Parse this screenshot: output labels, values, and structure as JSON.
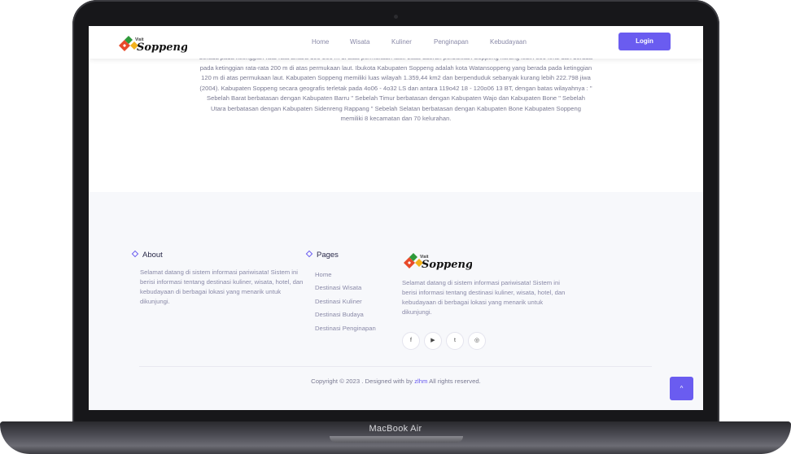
{
  "device": {
    "label": "MacBook Air"
  },
  "brand": {
    "small": "Visit",
    "name": "Soppeng",
    "accent": "#6a5cf0"
  },
  "navbar": {
    "items": [
      "Home",
      "Wisata",
      "Kuliner",
      "Penginapan",
      "Kebudayaan"
    ],
    "login_label": "Login"
  },
  "about_section": {
    "paragraph": "berada pada ketinggian rata-rata antara 100-200 m di atas permukaan laut. Luas daerah perbukitan Soppeng kurang lebih 800 km2 dan berada pada ketinggian rata-rata 200 m di atas permukaan laut. Ibukota Kabupaten Soppeng adalah kota Watansoppeng yang berada pada ketinggian 120 m di atas permukaan laut. Kabupaten Soppeng memiliki luas wilayah 1.359,44 km2 dan berpenduduk sebanyak kurang lebih 222.798 jiwa (2004). Kabupaten Soppeng secara geografis terletak pada 4o06 - 4o32 LS dan antara 119o42 18 - 120o06 13 BT, dengan batas wilayahnya : \" Sebelah Barat berbatasan dengan Kabupaten Barru \" Sebelah Timur berbatasan dengan Kabupaten Wajo dan Kabupaten Bone \" Sebelah Utara berbatasan dengan Kabupaten Sidenreng Rappang \" Sebelah Selatan berbatasan dengan Kabupaten Bone Kabupaten Soppeng memiliki 8 kecamatan dan 70 kelurahan."
  },
  "footer": {
    "about": {
      "title": "About",
      "text": "Selamat datang di sistem informasi pariwisata! Sistem ini berisi informasi tentang destinasi kuliner, wisata, hotel, dan kebudayaan di berbagai lokasi yang menarik untuk dikunjungi."
    },
    "pages": {
      "title": "Pages",
      "links": [
        "Home",
        "Destinasi Wisata",
        "Destinasi Kuliner",
        "Destinasi Budaya",
        "Destinasi Penginapan"
      ]
    },
    "brand_col": {
      "text": "Selamat datang di sistem informasi pariwisata! Sistem ini berisi informasi tentang destinasi kuliner, wisata, hotel, dan kebudayaan di berbagai lokasi yang menarik untuk dikunjungi."
    },
    "social": [
      {
        "icon": "facebook-icon",
        "glyph": "f"
      },
      {
        "icon": "youtube-icon",
        "glyph": "▶"
      },
      {
        "icon": "twitter-icon",
        "glyph": "t"
      },
      {
        "icon": "instagram-icon",
        "glyph": "◎"
      }
    ],
    "copyright_prefix": "Copyright © 2023 . Designed with by",
    "copyright_author": "zlhm",
    "copyright_suffix": "All rights reserved."
  },
  "back_to_top": {
    "glyph": "^"
  }
}
